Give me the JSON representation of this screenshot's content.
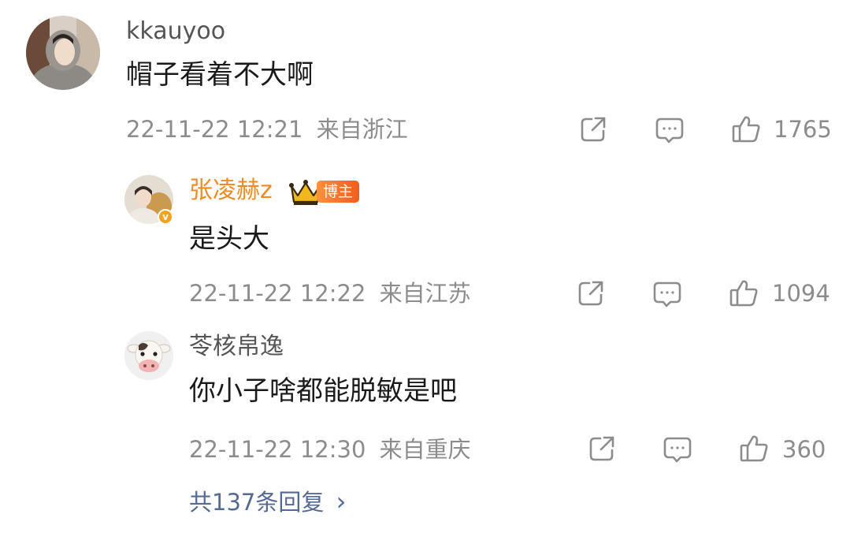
{
  "comments": [
    {
      "username": "kkauyoo",
      "content": "帽子看着不大啊",
      "time": "22-11-22 12:21",
      "location": "来自浙江",
      "likes": "1765",
      "avatar_icon": "user-photo"
    },
    {
      "username": "张凌赫z",
      "content": "是头大",
      "time": "22-11-22 12:22",
      "location": "来自江苏",
      "likes": "1094",
      "badge": "博主",
      "verified_mark": "v",
      "avatar_icon": "user-photo-with-dog"
    },
    {
      "username": "苓核帛逸",
      "content": "你小子啥都能脱敏是吧",
      "time": "22-11-22 12:30",
      "location": "来自重庆",
      "likes": "360",
      "avatar_icon": "cow-emoji"
    }
  ],
  "more_replies": {
    "label": "共137条回复",
    "chevron": "›"
  },
  "colors": {
    "blogger_name": "#f08a24",
    "meta_text": "#8c8c8c",
    "link": "#556a93",
    "badge_start": "#ff8f3f",
    "badge_end": "#f25d1e"
  }
}
